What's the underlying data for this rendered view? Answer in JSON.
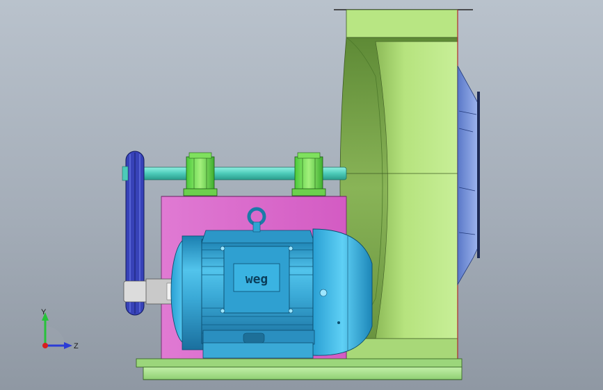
{
  "viewport": {
    "background_top": "#b9c2cc",
    "background_bottom": "#8f98a3"
  },
  "model": {
    "brand_text": "weg",
    "colors": {
      "fan_housing": "#b6e37e",
      "fan_housing_shadow": "#6f9a45",
      "impeller": "#6f8fd8",
      "motor": "#3aa9d6",
      "motor_highlight": "#8fe0ff",
      "base_plate": "#df6fd0",
      "bearing": "#79e35a",
      "shaft": "#56d4c3",
      "belt": "#3742b8",
      "frame": "#a8e18a"
    }
  },
  "triad": {
    "y_label": "Y",
    "z_label": "Z",
    "y_color": "#27c23a",
    "z_color": "#2b3cd6",
    "x_color": "#d81e1e"
  }
}
